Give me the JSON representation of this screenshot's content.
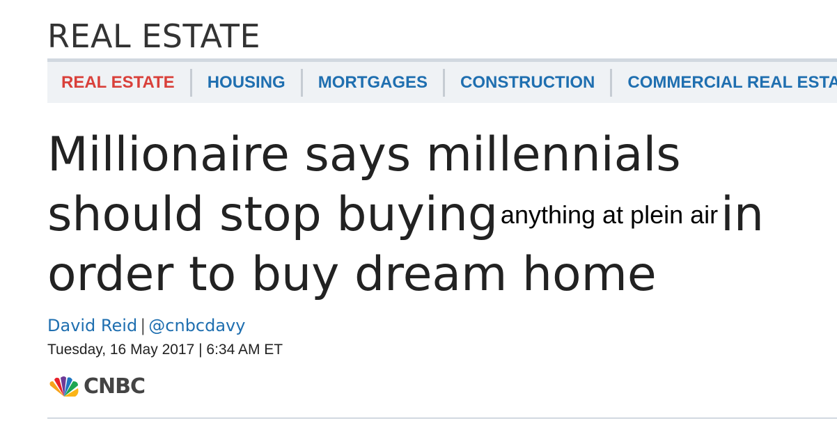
{
  "section": {
    "title": "REAL ESTATE"
  },
  "nav": {
    "items": [
      {
        "label": "REAL ESTATE"
      },
      {
        "label": "HOUSING"
      },
      {
        "label": "MORTGAGES"
      },
      {
        "label": "CONSTRUCTION"
      },
      {
        "label": "COMMERCIAL REAL ESTATE"
      }
    ]
  },
  "article": {
    "headline_line1": "Millionaire says millennials",
    "headline_line2_start": "should stop buying",
    "overlay_text": "anything at plein air",
    "headline_line2_end": "in",
    "headline_line3": "order to buy dream home",
    "author": "David Reid",
    "byline_separator": "|",
    "twitter": "@cnbcdavy",
    "date": "Tuesday, 16 May 2017 | 6:34 AM ET"
  },
  "logo": {
    "text": "CNBC",
    "icon": "nbc-peacock-icon",
    "colors": [
      "#f7a21b",
      "#e8202a",
      "#6e3a96",
      "#1f76c2",
      "#1ea651",
      "#fbb416"
    ]
  }
}
